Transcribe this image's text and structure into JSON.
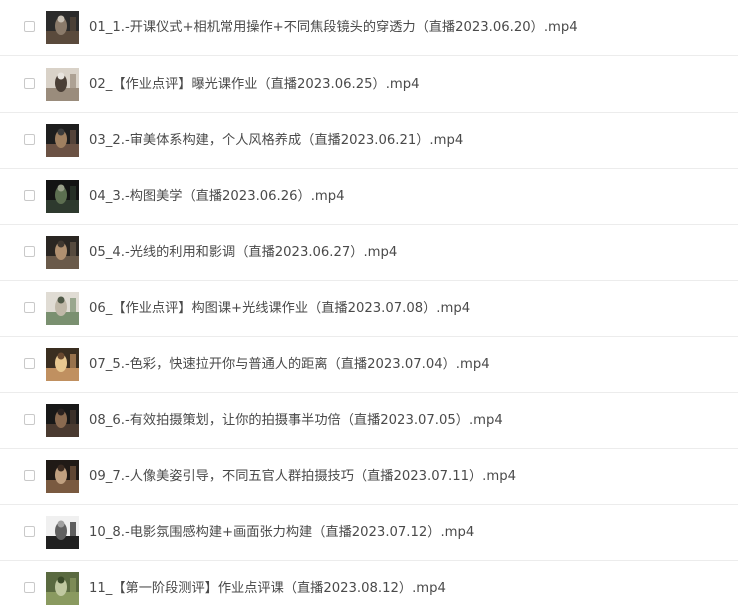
{
  "files": [
    {
      "name": "01_1.-开课仪式+相机常用操作+不同焦段镜头的穿透力（直播2023.06.20）.mp4",
      "thumbnail": "video-thumbnail-icon"
    },
    {
      "name": "02_【作业点评】曝光课作业（直播2023.06.25）.mp4",
      "thumbnail": "video-thumbnail-icon"
    },
    {
      "name": "03_2.-审美体系构建，个人风格养成（直播2023.06.21）.mp4",
      "thumbnail": "video-thumbnail-icon"
    },
    {
      "name": "04_3.-构图美学（直播2023.06.26）.mp4",
      "thumbnail": "video-thumbnail-icon"
    },
    {
      "name": "05_4.-光线的利用和影调（直播2023.06.27）.mp4",
      "thumbnail": "video-thumbnail-icon"
    },
    {
      "name": "06_【作业点评】构图课+光线课作业（直播2023.07.08）.mp4",
      "thumbnail": "video-thumbnail-icon"
    },
    {
      "name": "07_5.-色彩，快速拉开你与普通人的距离（直播2023.07.04）.mp4",
      "thumbnail": "video-thumbnail-icon"
    },
    {
      "name": "08_6.-有效拍摄策划，让你的拍摄事半功倍（直播2023.07.05）.mp4",
      "thumbnail": "video-thumbnail-icon"
    },
    {
      "name": "09_7.-人像美姿引导，不同五官人群拍摄技巧（直播2023.07.11）.mp4",
      "thumbnail": "video-thumbnail-icon"
    },
    {
      "name": "10_8.-电影氛围感构建+画面张力构建（直播2023.07.12）.mp4",
      "thumbnail": "video-thumbnail-icon"
    },
    {
      "name": "11_【第一阶段测评】作业点评课（直播2023.08.12）.mp4",
      "thumbnail": "video-thumbnail-icon"
    }
  ],
  "colors": {
    "text": "#4a4a4a",
    "divider": "#ececec",
    "checkbox_border": "#c9c9c9"
  }
}
